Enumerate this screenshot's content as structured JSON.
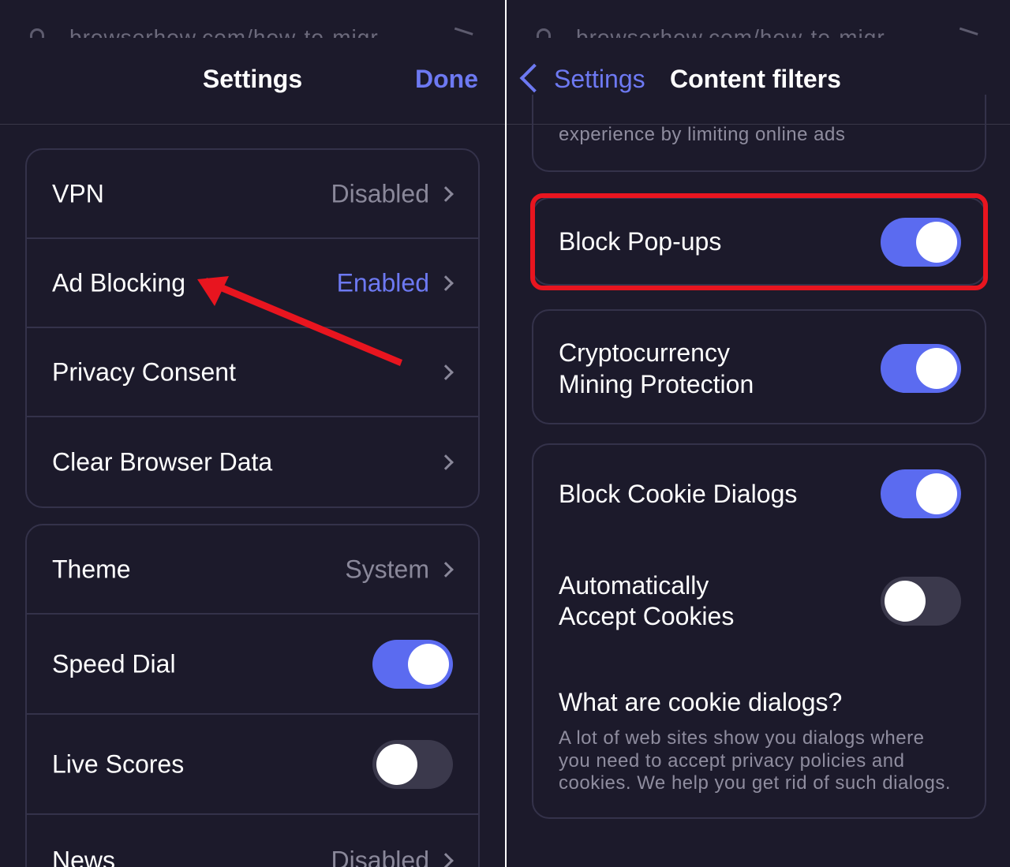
{
  "left": {
    "url": "browserhow.com/how-to-migr",
    "nav": {
      "title": "Settings",
      "done_label": "Done"
    },
    "group1": [
      {
        "label": "VPN",
        "value": "Disabled"
      },
      {
        "label": "Ad Blocking",
        "value": "Enabled"
      },
      {
        "label": "Privacy Consent",
        "value": ""
      },
      {
        "label": "Clear Browser Data",
        "value": ""
      }
    ],
    "group2": {
      "theme": {
        "label": "Theme",
        "value": "System"
      },
      "speed_dial": {
        "label": "Speed Dial",
        "on": true
      },
      "live_scores": {
        "label": "Live Scores",
        "on": false
      },
      "news": {
        "label": "News",
        "value": "Disabled"
      }
    }
  },
  "right": {
    "url": "browserhow.com/how-to-migr",
    "nav": {
      "back_label": "Settings",
      "title": "Content filters"
    },
    "ad_desc_tail": "experience by limiting online ads",
    "block_popups": {
      "label": "Block Pop-ups",
      "on": true
    },
    "crypto": {
      "label_line1": "Cryptocurrency",
      "label_line2": "Mining Protection",
      "on": true
    },
    "cookie_dialogs": {
      "label": "Block Cookie Dialogs",
      "on": true
    },
    "accept_cookies": {
      "label_line1": "Automatically",
      "label_line2": "Accept Cookies",
      "on": false
    },
    "info": {
      "title": "What are cookie dialogs?",
      "line1": "A lot of web sites show you dialogs where",
      "line2": "you need to accept privacy policies and",
      "line3": "cookies. We help you get rid of such dialogs."
    }
  },
  "colors": {
    "accent": "#6d79f2",
    "toggle_on": "#5b6bf0",
    "highlight": "#e8151f",
    "background": "#1c1a2b"
  }
}
